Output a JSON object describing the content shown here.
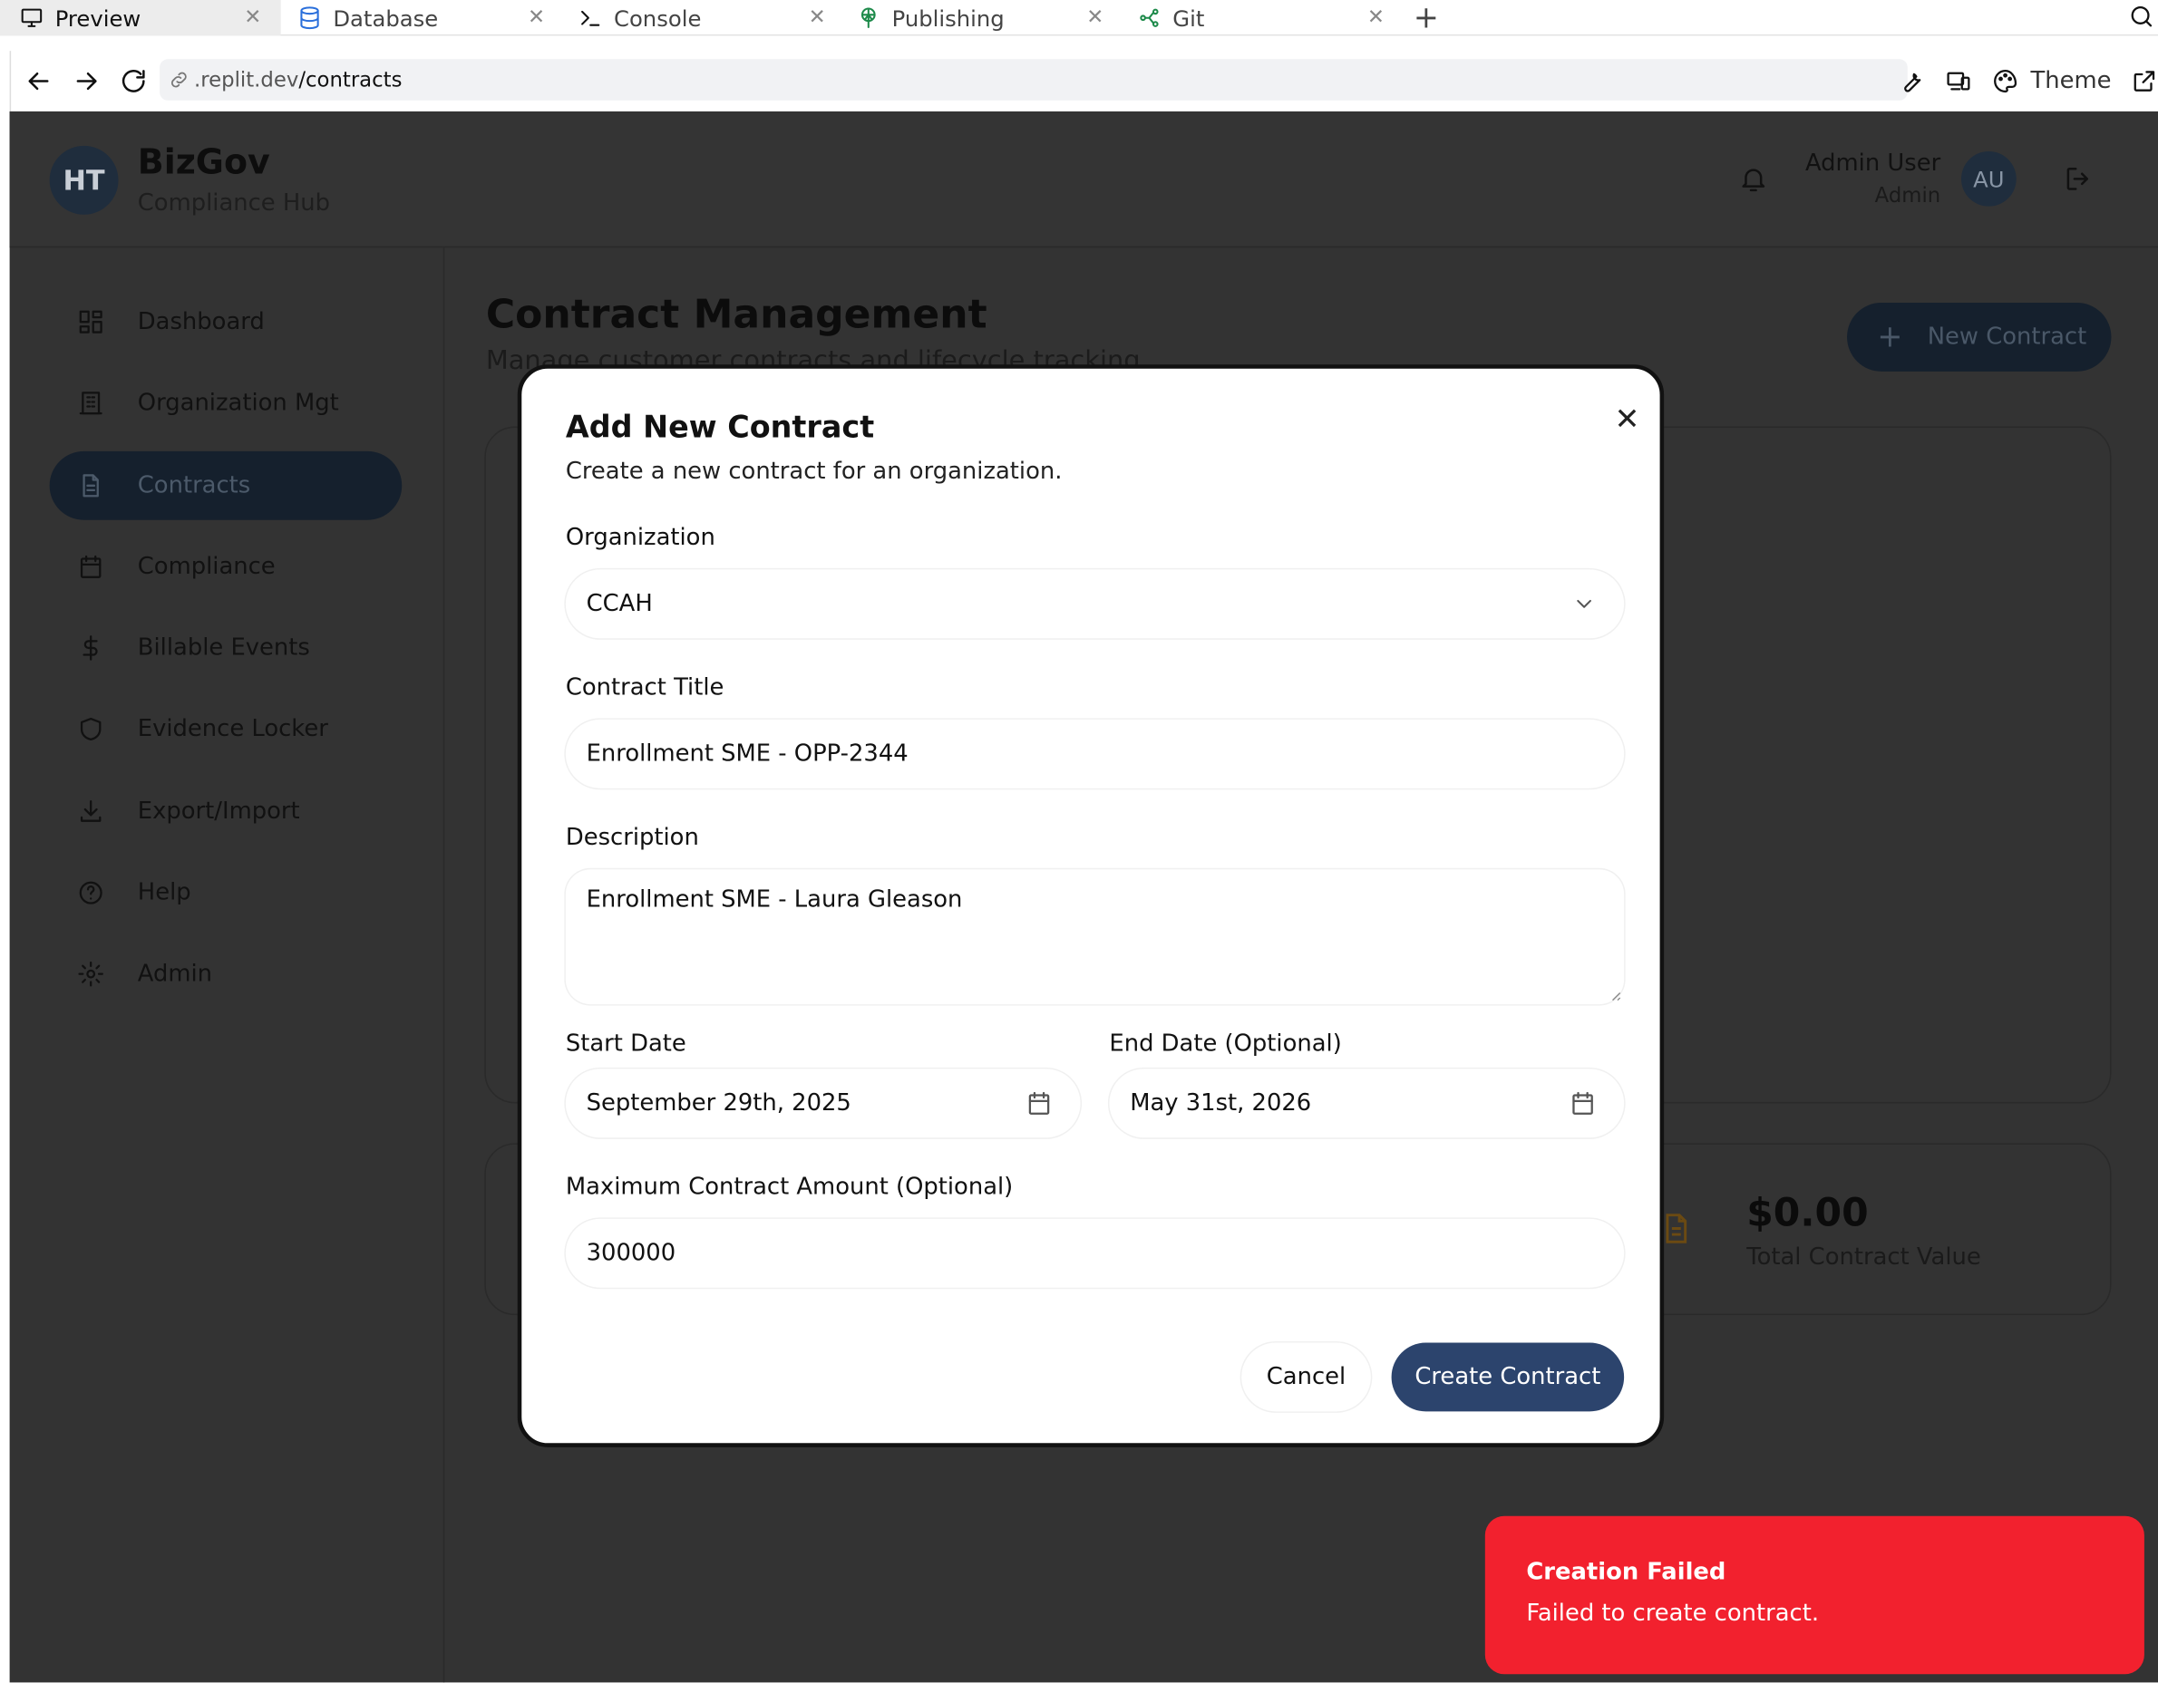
{
  "tabs": [
    {
      "label": "Preview",
      "active": true
    },
    {
      "label": "Database",
      "active": false
    },
    {
      "label": "Console",
      "active": false
    },
    {
      "label": "Publishing",
      "active": false
    },
    {
      "label": "Git",
      "active": false
    }
  ],
  "address": {
    "host": ".replit.dev",
    "path": "/contracts",
    "theme_label": "Theme"
  },
  "app": {
    "logo_initials": "HT",
    "brand": "BizGov",
    "brand_sub": "Compliance Hub",
    "user": {
      "name": "Admin User",
      "role": "Admin",
      "initials": "AU"
    }
  },
  "sidebar": {
    "items": [
      {
        "label": "Dashboard",
        "icon": "dashboard-icon",
        "active": false
      },
      {
        "label": "Organization Mgt",
        "icon": "building-icon",
        "active": false
      },
      {
        "label": "Contracts",
        "icon": "document-icon",
        "active": true
      },
      {
        "label": "Compliance",
        "icon": "calendar-icon",
        "active": false
      },
      {
        "label": "Billable Events",
        "icon": "dollar-icon",
        "active": false
      },
      {
        "label": "Evidence Locker",
        "icon": "shield-icon",
        "active": false
      },
      {
        "label": "Export/Import",
        "icon": "download-icon",
        "active": false
      },
      {
        "label": "Help",
        "icon": "help-icon",
        "active": false
      },
      {
        "label": "Admin",
        "icon": "gear-icon",
        "active": false
      }
    ]
  },
  "main": {
    "title": "Contract Management",
    "subtitle": "Manage customer contracts and lifecycle tracking",
    "new_button": "New Contract",
    "stat": {
      "value": "$0.00",
      "label": "Total Contract Value"
    }
  },
  "modal": {
    "title": "Add New Contract",
    "subtitle": "Create a new contract for an organization.",
    "organization_label": "Organization",
    "organization_value": "CCAH",
    "title_label": "Contract Title",
    "title_value": "Enrollment SME - OPP-2344",
    "description_label": "Description",
    "description_value": "Enrollment SME - Laura Gleason",
    "start_label": "Start Date",
    "start_value": "September 29th, 2025",
    "end_label": "End Date (Optional)",
    "end_value": "May 31st, 2026",
    "amount_label": "Maximum Contract Amount (Optional)",
    "amount_value": "300000",
    "cancel": "Cancel",
    "create": "Create Contract"
  },
  "toast": {
    "title": "Creation Failed",
    "message": "Failed to create contract.",
    "color": "#f2212e"
  }
}
